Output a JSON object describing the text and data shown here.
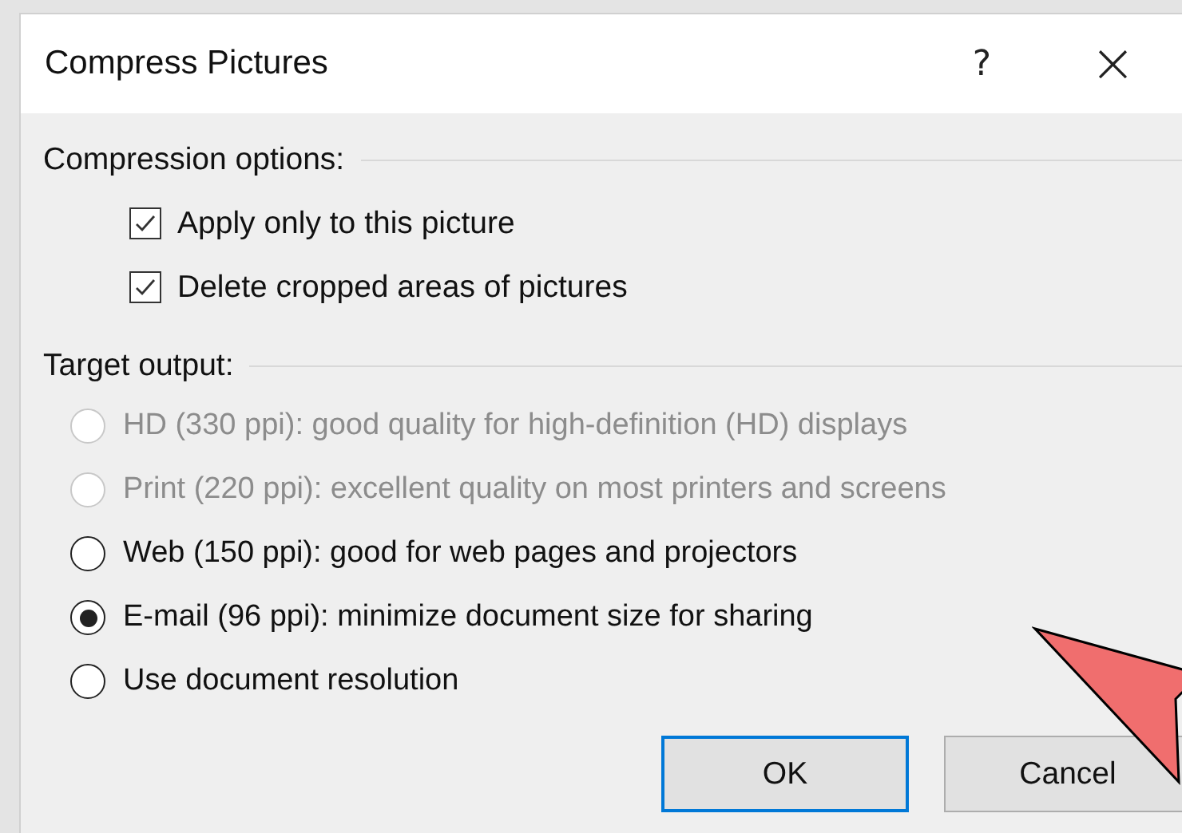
{
  "window": {
    "title": "Compress Pictures",
    "help_button": "?",
    "close_button": "×"
  },
  "compression_options": {
    "label": "Compression options:",
    "checkboxes": [
      {
        "label": "Apply only to this picture",
        "checked": true
      },
      {
        "label": "Delete cropped areas of pictures",
        "checked": true
      }
    ]
  },
  "target_output": {
    "label": "Target output:",
    "radios": [
      {
        "label": "HD (330 ppi): good quality for high-definition (HD) displays",
        "selected": false,
        "disabled": true
      },
      {
        "label": "Print (220 ppi): excellent quality on most printers and screens",
        "selected": false,
        "disabled": true
      },
      {
        "label": "Web (150 ppi): good for web pages and projectors",
        "selected": false,
        "disabled": false
      },
      {
        "label": "E-mail (96 ppi): minimize document size for sharing",
        "selected": true,
        "disabled": false
      },
      {
        "label": "Use document resolution",
        "selected": false,
        "disabled": false
      }
    ]
  },
  "buttons": [
    {
      "label": "OK",
      "default": true
    },
    {
      "label": "Cancel",
      "default": false
    }
  ]
}
